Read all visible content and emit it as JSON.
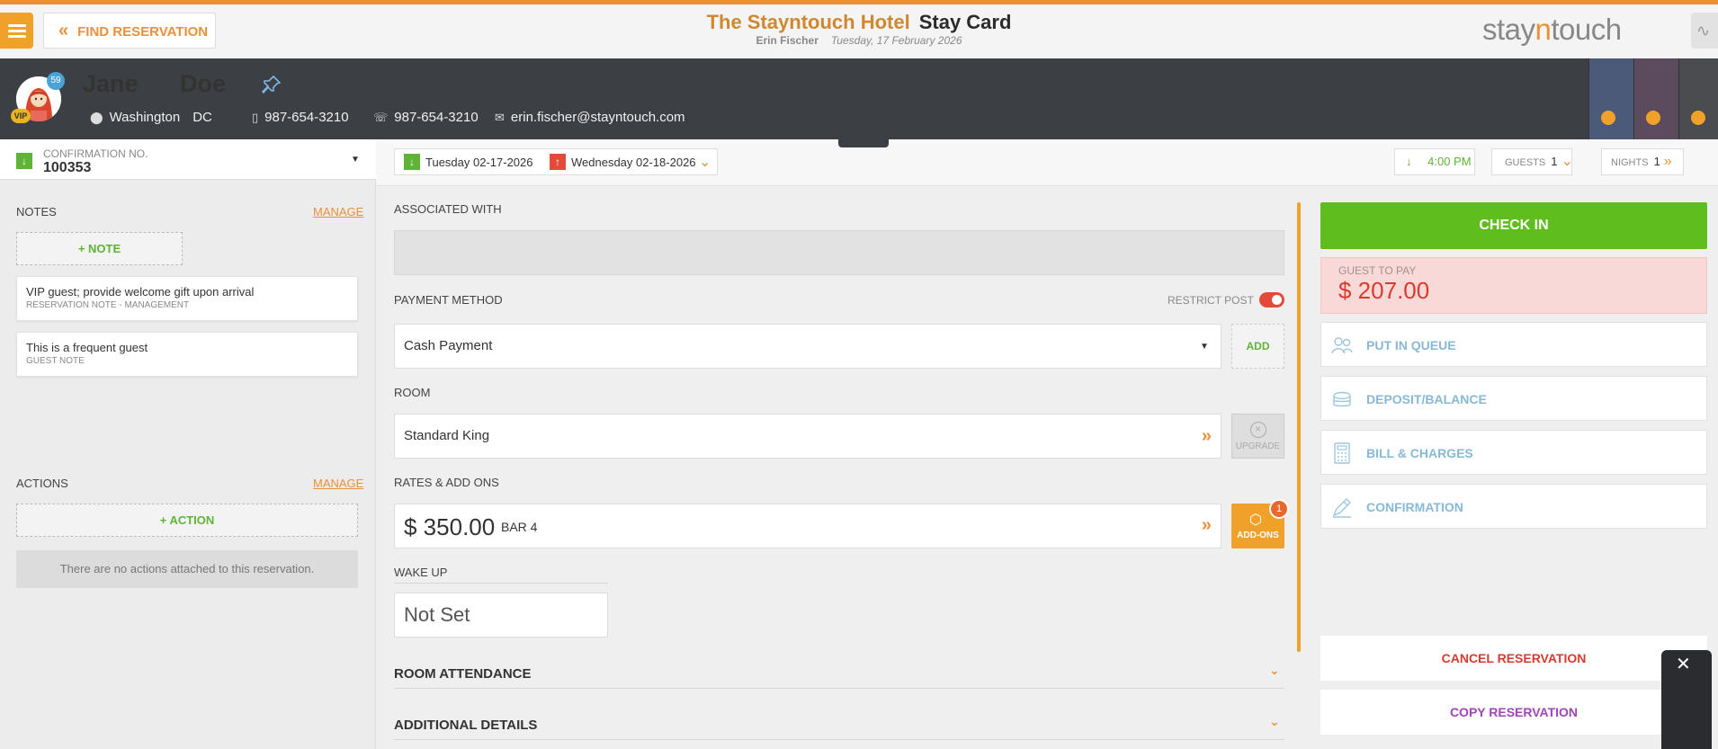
{
  "header": {
    "find_reservation": "FIND RESERVATION",
    "hotel_name": "The Stayntouch Hotel",
    "screen_title": "Stay Card",
    "user_name": "Erin Fischer",
    "business_date": "Tuesday, 17 February 2026",
    "brand_prefix": "stay",
    "brand_n": "n",
    "brand_suffix": "touch",
    "brand_color": "#e8913a"
  },
  "guest": {
    "first_name": "Jane",
    "last_name": "Doe",
    "vip_badge": "VIP",
    "loyalty_count": "59",
    "city": "Washington",
    "state": "DC",
    "phone_mobile": "987-654-3210",
    "phone_home": "987-654-3210",
    "email": "erin.fischer@stayntouch.com"
  },
  "confirmation": {
    "label": "CONFIRMATION NO.",
    "number": "100353"
  },
  "stay": {
    "arrival": "Tuesday 02-17-2026",
    "departure": "Wednesday 02-18-2026",
    "arrival_time": "4:00 PM",
    "guests_label": "GUESTS",
    "guests_value": "1",
    "nights_label": "NIGHTS",
    "nights_value": "1"
  },
  "notes": {
    "title": "NOTES",
    "manage": "MANAGE",
    "add_label": "+ NOTE",
    "items": [
      {
        "text": "VIP guest; provide welcome gift upon arrival",
        "meta": "RESERVATION NOTE - MANAGEMENT"
      },
      {
        "text": "This is a frequent guest",
        "meta": "GUEST NOTE"
      }
    ]
  },
  "actions": {
    "title": "ACTIONS",
    "manage": "MANAGE",
    "add_label": "+ ACTION",
    "empty_text": "There are no actions attached to this reservation."
  },
  "center": {
    "associated_label": "ASSOCIATED WITH",
    "payment_label": "PAYMENT METHOD",
    "restrict_post_label": "RESTRICT POST",
    "payment_value": "Cash Payment",
    "add_button": "ADD",
    "room_label": "ROOM",
    "room_value": "Standard King",
    "upgrade_button": "UPGRADE",
    "rates_label": "RATES & ADD ONS",
    "rate_amount": "$ 350.00",
    "rate_code": "BAR 4",
    "addons_button": "ADD-ONS",
    "addons_count": "1",
    "wakeup_label": "WAKE UP",
    "wakeup_value": "Not Set",
    "room_attendance": "ROOM ATTENDANCE",
    "additional_details": "ADDITIONAL DETAILS"
  },
  "right": {
    "check_in": "CHECK IN",
    "guest_to_pay_label": "GUEST TO PAY",
    "guest_to_pay_amount": "$ 207.00",
    "put_in_queue": "PUT IN QUEUE",
    "deposit_balance": "DEPOSIT/BALANCE",
    "bill_charges": "BILL & CHARGES",
    "confirmation": "CONFIRMATION",
    "cancel_reservation": "CANCEL RESERVATION",
    "copy_reservation": "COPY RESERVATION"
  },
  "colors": {
    "accent_orange": "#e8913a",
    "check_in_green": "#5fbd1e",
    "alert_red": "#d83b2e",
    "action_blue": "#87b9d5",
    "copy_purple": "#a044b8"
  }
}
